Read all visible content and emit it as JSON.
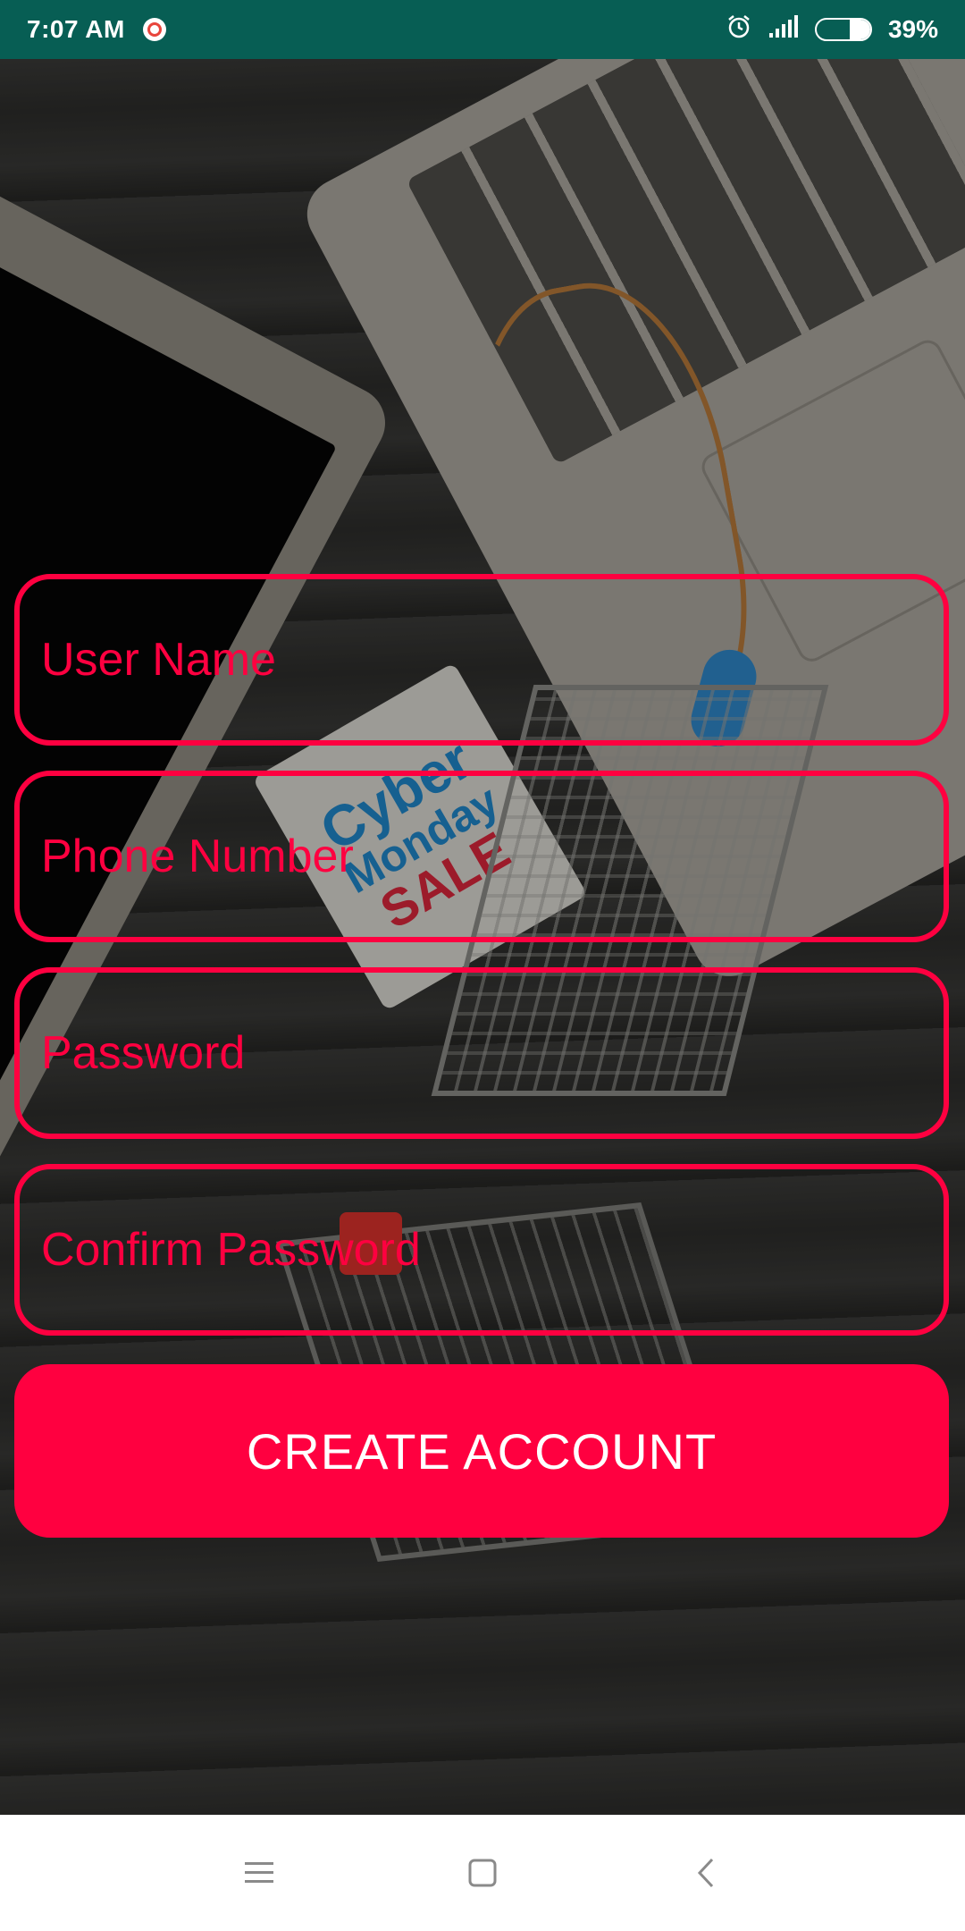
{
  "status_bar": {
    "time": "7:07 AM",
    "icons": [
      "clock-app-icon",
      "alarm-icon",
      "signal-icon",
      "battery-icon"
    ],
    "battery_level": 0.39,
    "battery_text": "39%",
    "background_color": "#075e54"
  },
  "background": {
    "tag_text": [
      "Cyber",
      "Monday",
      "SALE"
    ]
  },
  "form": {
    "user_name_placeholder": "User Name",
    "phone_number_placeholder": "Phone Number",
    "password_placeholder": "Password",
    "confirm_password_placeholder": "Confirm Password",
    "create_account_label": "CREATE ACCOUNT",
    "accent_color": "#ff0040"
  },
  "nav_bar": {
    "icons": [
      "menu-icon",
      "home-icon",
      "back-icon"
    ]
  }
}
